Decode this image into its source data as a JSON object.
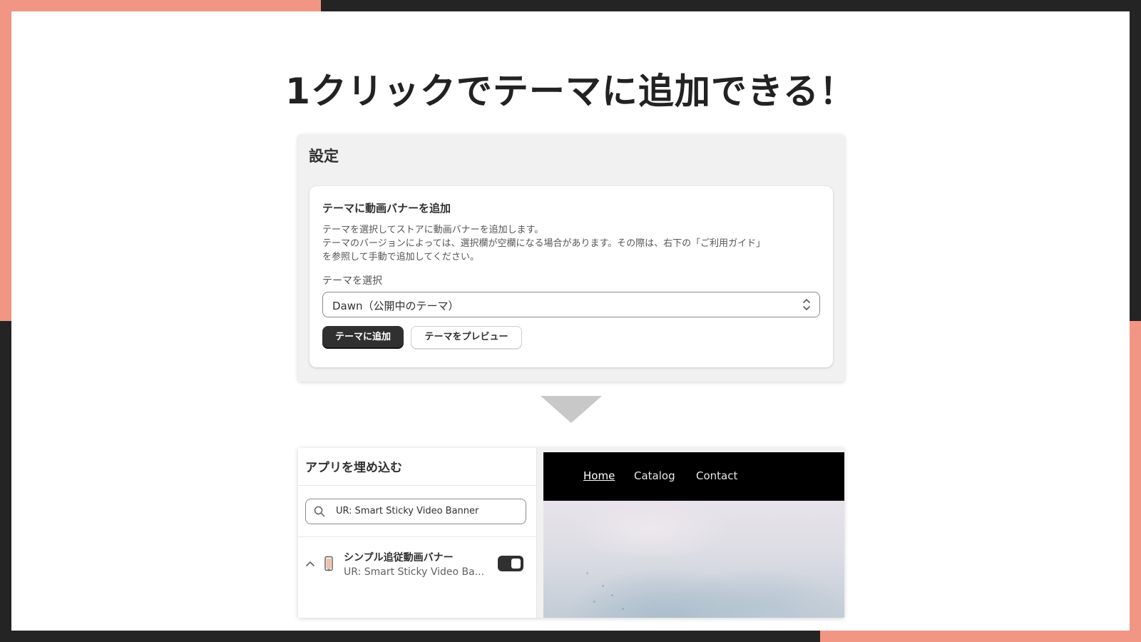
{
  "slide": {
    "headline": "1クリックでテーマに追加できる！"
  },
  "settings": {
    "title": "設定",
    "card": {
      "title": "テーマに動画バナーを追加",
      "desc_line1": "テーマを選択してストアに動画バナーを追加します。",
      "desc_line2": "テーマのバージョンによっては、選択欄が空欄になる場合があります。その際は、右下の「ご利用ガイド」",
      "desc_line3": "を参照して手動で追加してください。",
      "select_label": "テーマを選択",
      "select_value": "Dawn（公開中のテーマ）",
      "add_button": "テーマに追加",
      "preview_button": "テーマをプレビュー"
    }
  },
  "embed": {
    "title": "アプリを埋め込む",
    "search_value": "UR: Smart Sticky Video Banner",
    "app_item": {
      "name": "シンプル追従動画バナー",
      "subtitle": "UR: Smart Sticky Video Ba...",
      "enabled": true
    },
    "preview_nav": {
      "home": "Home",
      "catalog": "Catalog",
      "contact": "Contact"
    }
  },
  "colors": {
    "accent": "#f19585",
    "frame": "#242424",
    "primary_button": "#303030"
  },
  "icons": [
    "search-icon",
    "chevron-up-icon",
    "phone-icon",
    "select-arrows-icon",
    "down-arrow-icon"
  ]
}
